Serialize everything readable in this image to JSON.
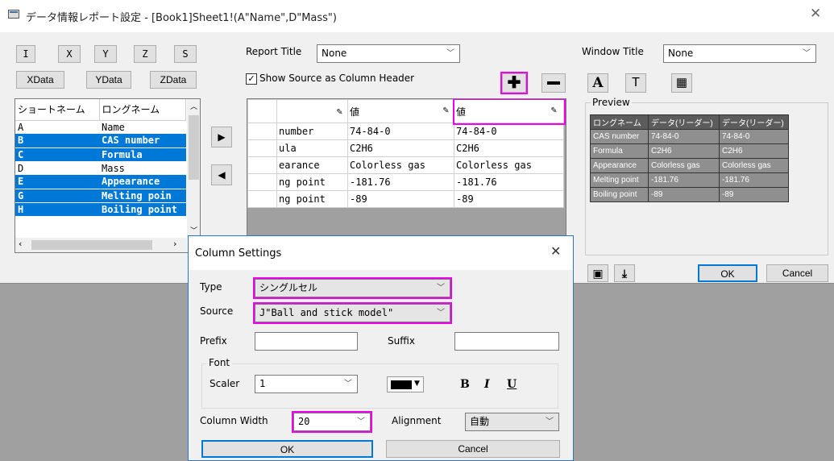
{
  "window": {
    "title": "データ情報レポート設定 - [Book1]Sheet1!(A\"Name\",D\"Mass\")",
    "close": "✕"
  },
  "toolbar": {
    "row1": [
      "I",
      "X",
      "Y",
      "Z",
      "S"
    ],
    "row2": [
      "XData",
      "YData",
      "ZData"
    ]
  },
  "report_title": {
    "label": "Report Title",
    "value": "None"
  },
  "show_source": {
    "label": "Show Source as Column Header",
    "checked": true
  },
  "window_title": {
    "label": "Window Title",
    "value": "None"
  },
  "list": {
    "headers": [
      "ショートネーム",
      "ロングネーム"
    ],
    "rows": [
      {
        "short": "A",
        "long": "Name",
        "selected": false
      },
      {
        "short": "B",
        "long": "CAS number",
        "selected": true
      },
      {
        "short": "C",
        "long": "Formula",
        "selected": true
      },
      {
        "short": "D",
        "long": "Mass",
        "selected": false
      },
      {
        "short": "E",
        "long": "Appearance",
        "selected": true
      },
      {
        "short": "G",
        "long": "Melting poin",
        "selected": true
      },
      {
        "short": "H",
        "long": "Boiling point",
        "selected": true
      }
    ]
  },
  "grid": {
    "headers": [
      "",
      "値",
      "値"
    ],
    "rows": [
      [
        "number",
        "74-84-0",
        "74-84-0"
      ],
      [
        "ula",
        "C2H6",
        "C2H6"
      ],
      [
        "earance",
        "Colorless gas",
        "Colorless gas"
      ],
      [
        "ng point",
        "-181.76",
        "-181.76"
      ],
      [
        "ng point",
        "-89",
        "-89"
      ]
    ]
  },
  "preview": {
    "label": "Preview",
    "headers": [
      "ロングネーム",
      "データ(リーダー)",
      "データ(リーダー)"
    ],
    "rows": [
      [
        "CAS number",
        "74-84-0",
        "74-84-0"
      ],
      [
        "Formula",
        "C2H6",
        "C2H6"
      ],
      [
        "Appearance",
        "Colorless gas",
        "Colorless gas"
      ],
      [
        "Melting point",
        "-181.76",
        "-181.76"
      ],
      [
        "Boiling point",
        "-89",
        "-89"
      ]
    ]
  },
  "buttons": {
    "ok": "OK",
    "cancel": "Cancel"
  },
  "dialog": {
    "title": "Column Settings",
    "close": "✕",
    "type_label": "Type",
    "type_value": "シングルセル",
    "source_label": "Source",
    "source_value": "J\"Ball and stick model\"",
    "prefix_label": "Prefix",
    "prefix_value": "",
    "suffix_label": "Suffix",
    "suffix_value": "",
    "font_group": "Font",
    "scaler_label": "Scaler",
    "scaler_value": "1",
    "bold": "B",
    "italic": "I",
    "underline": "U",
    "col_width_label": "Column Width",
    "col_width_value": "20",
    "alignment_label": "Alignment",
    "alignment_value": "自動",
    "ok": "OK",
    "cancel": "Cancel"
  },
  "colors": {
    "highlight": "#ee00ee",
    "selection": "#0078d7"
  }
}
